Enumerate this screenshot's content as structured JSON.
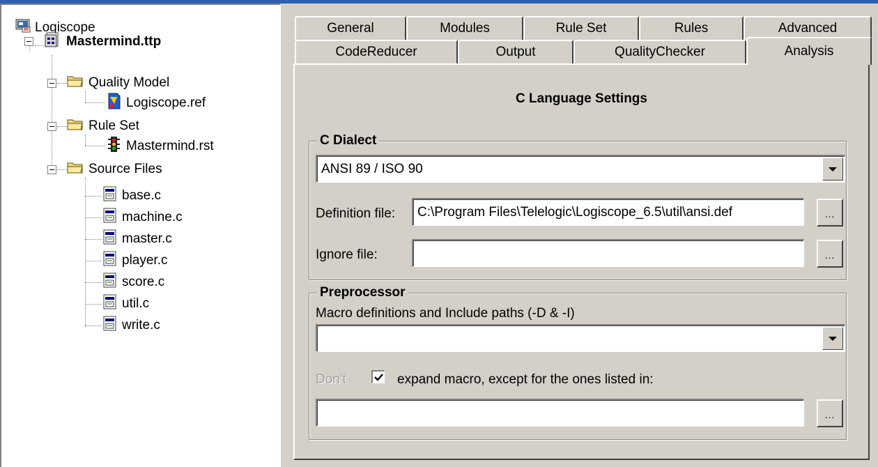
{
  "tree": {
    "root_label": "Logiscope",
    "project": "Mastermind.ttp",
    "nodes": [
      {
        "label": "Quality Model",
        "children": [
          "Logiscope.ref"
        ]
      },
      {
        "label": "Rule Set",
        "children": [
          "Mastermind.rst"
        ]
      },
      {
        "label": "Source Files",
        "children": [
          "base.c",
          "machine.c",
          "master.c",
          "player.c",
          "score.c",
          "util.c",
          "write.c"
        ]
      }
    ]
  },
  "tabs": {
    "row1": [
      "General",
      "Modules",
      "Rule Set",
      "Rules",
      "Advanced"
    ],
    "row2": [
      "CodeReducer",
      "Output",
      "QualityChecker",
      "Analysis"
    ],
    "active": "Analysis"
  },
  "analysis": {
    "title": "C Language Settings",
    "dialect": {
      "group_label": "C Dialect",
      "selected": "ANSI 89 / ISO 90",
      "definition_label": "Definition file:",
      "definition_value": "C:\\Program Files\\Telelogic\\Logiscope_6.5\\util\\ansi.def",
      "ignore_label": "Ignore file:",
      "ignore_value": "",
      "browse_label": "..."
    },
    "preprocessor": {
      "group_label": "Preprocessor",
      "macro_label": "Macro definitions and Include paths (-D & -I)",
      "macro_value": "",
      "dont_label": "Don't",
      "expand_checked": true,
      "expand_label": "expand macro, except for the ones listed in:",
      "exception_value": "",
      "browse_label": "..."
    }
  },
  "colors": {
    "window_bg": "#d4d0c8",
    "title_accent": "#2d5fb3",
    "tree_bg": "#ffffff"
  }
}
